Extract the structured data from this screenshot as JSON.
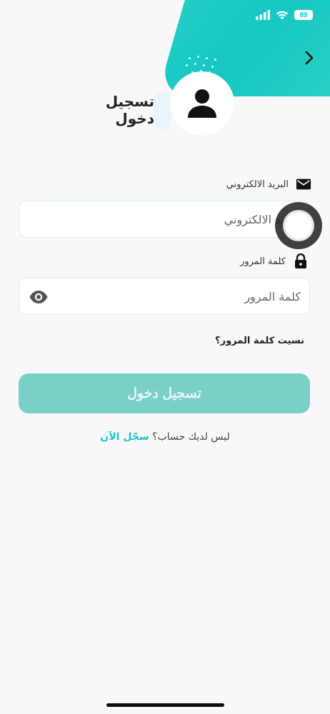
{
  "status_bar": {
    "battery": "89"
  },
  "header": {
    "title": "تسجيل دخول"
  },
  "email": {
    "label": "البريد الالكتروني",
    "placeholder": "البريد الالكتروني"
  },
  "password": {
    "label": "كلمة المرور",
    "placeholder": "كلمة المرور"
  },
  "forgot_password": "نسيت كلمة المرور؟",
  "login_button": "تسجيل دخول",
  "register": {
    "prompt": "ليس لديك حساب؟",
    "link": "سجّل الآن"
  },
  "colors": {
    "accent": "#19c6c2",
    "button": "#7ad0c6",
    "background": "#f8f8fa"
  },
  "icons": [
    "signal-icon",
    "wifi-icon",
    "battery-icon",
    "chevron-right-icon",
    "user-icon",
    "envelope-icon",
    "lock-icon",
    "eye-icon"
  ]
}
